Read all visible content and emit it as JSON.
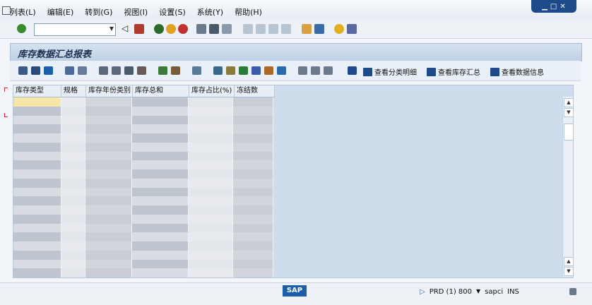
{
  "menubar": {
    "items": [
      "列表(L)",
      "编辑(E)",
      "转到(G)",
      "视图(I)",
      "设置(S)",
      "系统(Y)",
      "帮助(H)"
    ]
  },
  "toolbar1": {
    "command_value": ""
  },
  "report": {
    "title": "库存数据汇总报表",
    "buttons": [
      "查看分类明细",
      "查看库存汇总",
      "查看数据信息"
    ]
  },
  "table": {
    "columns": [
      "库存类型",
      "规格",
      "库存年份类别",
      "库存总和",
      "库存占比(%)",
      "冻结数"
    ]
  },
  "status": {
    "system": "PRD (1) 800",
    "server": "sapci",
    "mode": "INS",
    "logo": "SAP"
  },
  "colors": {
    "accent": "#1f4a8a",
    "header_bg": "#d6e2f0",
    "grid_bg": "#cfdceb"
  }
}
